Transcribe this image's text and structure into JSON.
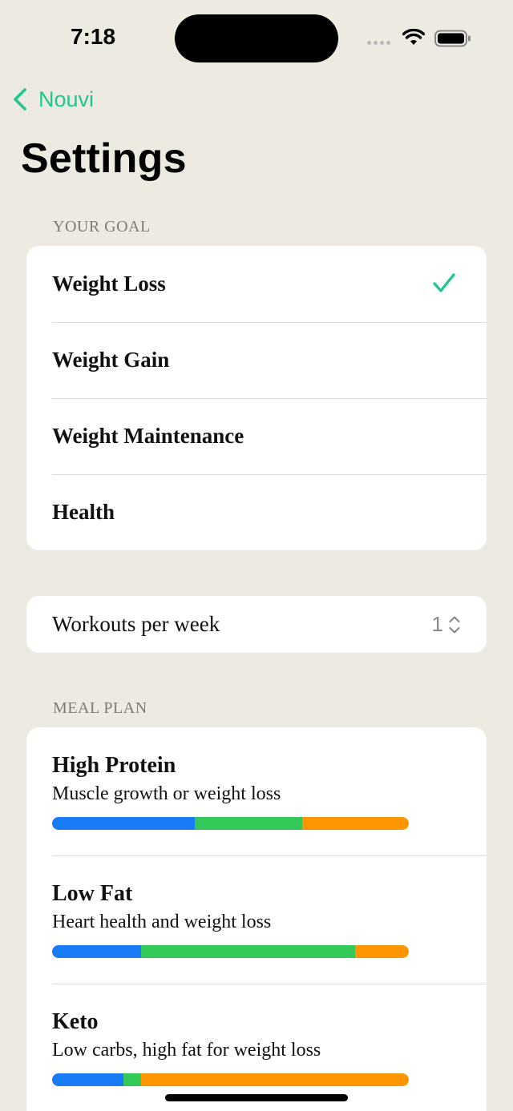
{
  "status_bar": {
    "time": "7:18"
  },
  "nav": {
    "back_label": "Nouvi",
    "title": "Settings"
  },
  "colors": {
    "accent": "#1FC78E",
    "protein": "#1A7CF4",
    "carbs": "#34C759",
    "fat": "#FF9500",
    "background": "#EDEAE1"
  },
  "goal_section": {
    "header": "YOUR GOAL",
    "options": [
      {
        "label": "Weight Loss",
        "selected": true
      },
      {
        "label": "Weight Gain",
        "selected": false
      },
      {
        "label": "Weight Maintenance",
        "selected": false
      },
      {
        "label": "Health",
        "selected": false
      }
    ]
  },
  "workouts": {
    "label": "Workouts per week",
    "value": "1"
  },
  "meal_section": {
    "header": "MEAL PLAN",
    "plans": [
      {
        "name": "High Protein",
        "description": "Muscle growth or weight loss",
        "macros": {
          "protein": 0.4,
          "carbs": 0.3,
          "fat": 0.3
        }
      },
      {
        "name": "Low Fat",
        "description": "Heart health and weight loss",
        "macros": {
          "protein": 0.25,
          "carbs": 0.6,
          "fat": 0.15
        }
      },
      {
        "name": "Keto",
        "description": "Low carbs, high fat for weight loss",
        "macros": {
          "protein": 0.2,
          "carbs": 0.05,
          "fat": 0.75
        }
      }
    ]
  }
}
